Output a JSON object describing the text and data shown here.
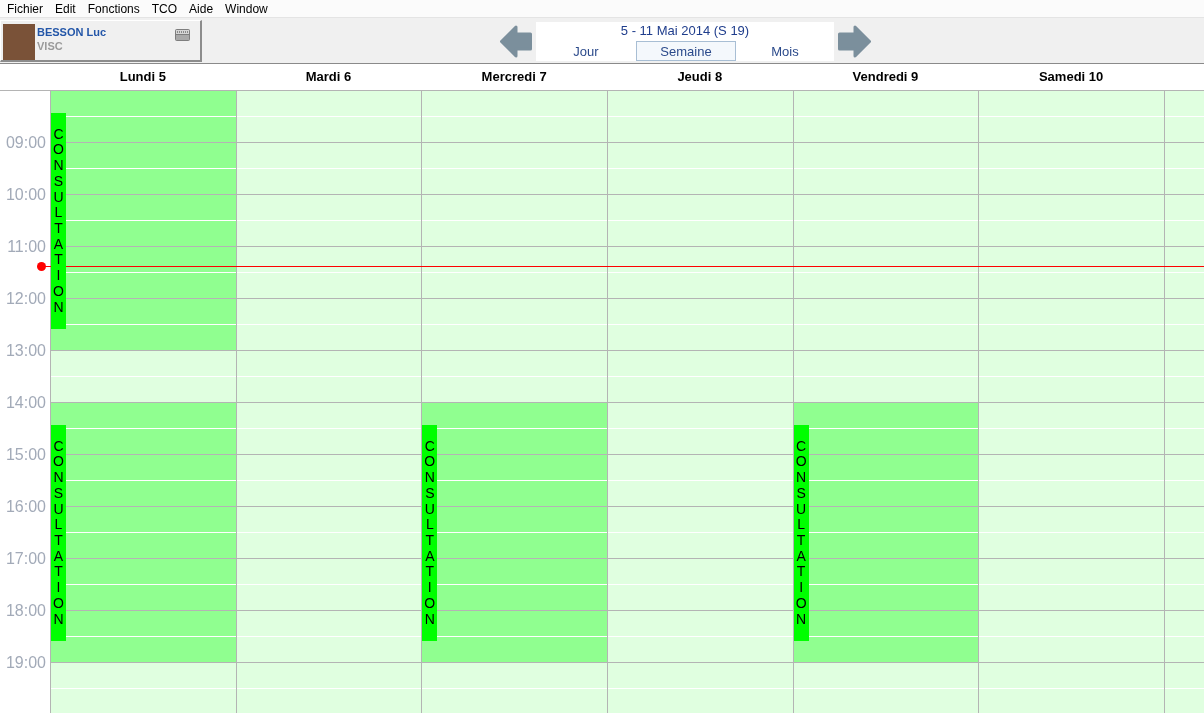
{
  "menu_bar": {
    "items": [
      "Fichier",
      "Edit",
      "Fonctions",
      "TCO",
      "Aide",
      "Window"
    ]
  },
  "user": {
    "name": "BESSON Luc",
    "role": "VISC"
  },
  "navigation": {
    "period": "5 - 11 Mai 2014 (S 19)",
    "views": [
      {
        "label": "Jour",
        "selected": false
      },
      {
        "label": "Semaine",
        "selected": true
      },
      {
        "label": "Mois",
        "selected": false
      }
    ]
  },
  "calendar": {
    "time_labels": [
      "09:00",
      "10:00",
      "11:00",
      "12:00",
      "13:00",
      "14:00",
      "15:00",
      "16:00",
      "17:00",
      "18:00",
      "19:00"
    ],
    "days": [
      {
        "label": "Lundi 5",
        "hours": [
          {
            "available": true
          },
          {
            "available": true
          },
          {
            "available": true
          },
          {
            "available": true
          },
          {
            "available": true
          },
          {
            "available": false
          },
          {
            "available": true
          },
          {
            "available": true
          },
          {
            "available": true
          },
          {
            "available": true
          },
          {
            "available": true
          },
          {
            "available": false
          }
        ],
        "appointments": [
          {
            "label": "CONSULTATION"
          },
          {
            "label": "CONSULTATION"
          }
        ]
      },
      {
        "label": "Mardi 6",
        "hours": [
          {
            "available": false
          },
          {
            "available": false
          },
          {
            "available": false
          },
          {
            "available": false
          },
          {
            "available": false
          },
          {
            "available": false
          },
          {
            "available": false
          },
          {
            "available": false
          },
          {
            "available": false
          },
          {
            "available": false
          },
          {
            "available": false
          },
          {
            "available": false
          }
        ]
      },
      {
        "label": "Mercredi 7",
        "hours": [
          {
            "available": false
          },
          {
            "available": false
          },
          {
            "available": false
          },
          {
            "available": false
          },
          {
            "available": false
          },
          {
            "available": false
          },
          {
            "available": true
          },
          {
            "available": true
          },
          {
            "available": true
          },
          {
            "available": true
          },
          {
            "available": true
          },
          {
            "available": false
          }
        ],
        "appointments": [
          {
            "label": "CONSULTATION"
          }
        ]
      },
      {
        "label": "Jeudi 8",
        "hours": [
          {
            "available": false
          },
          {
            "available": false
          },
          {
            "available": false
          },
          {
            "available": false
          },
          {
            "available": false
          },
          {
            "available": false
          },
          {
            "available": false
          },
          {
            "available": false
          },
          {
            "available": false
          },
          {
            "available": false
          },
          {
            "available": false
          },
          {
            "available": false
          }
        ]
      },
      {
        "label": "Vendredi 9",
        "hours": [
          {
            "available": false
          },
          {
            "available": false
          },
          {
            "available": false
          },
          {
            "available": false
          },
          {
            "available": false
          },
          {
            "available": false
          },
          {
            "available": true
          },
          {
            "available": true
          },
          {
            "available": true
          },
          {
            "available": true
          },
          {
            "available": true
          },
          {
            "available": false
          }
        ],
        "appointments": [
          {
            "label": "CONSULTATION"
          }
        ]
      },
      {
        "label": "Samedi 10",
        "hours": [
          {
            "available": false
          },
          {
            "available": false
          },
          {
            "available": false
          },
          {
            "available": false
          },
          {
            "available": false
          },
          {
            "available": false
          },
          {
            "available": false
          },
          {
            "available": false
          },
          {
            "available": false
          },
          {
            "available": false
          },
          {
            "available": false
          },
          {
            "available": false
          }
        ]
      }
    ]
  }
}
